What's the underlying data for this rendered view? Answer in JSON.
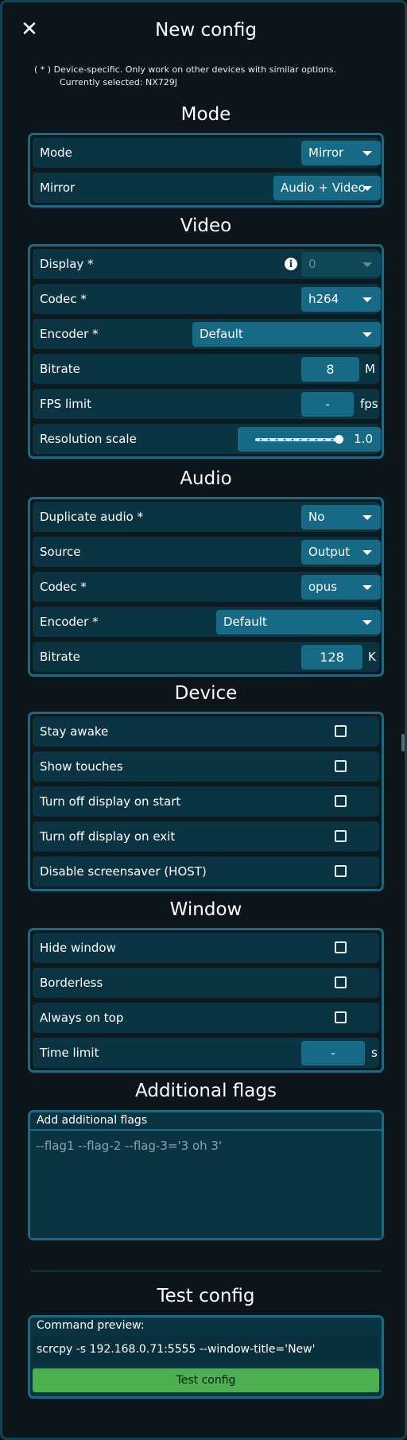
{
  "header": {
    "title": "New config",
    "close_icon": "close-icon"
  },
  "note": {
    "line1": "( * ) Device-specific. Only work on other devices with similar options.",
    "line2": "Currently selected: NX729J"
  },
  "mode": {
    "title": "Mode",
    "mode_label": "Mode",
    "mode_value": "Mirror",
    "mirror_label": "Mirror",
    "mirror_value": "Audio + Video"
  },
  "video": {
    "title": "Video",
    "display_label": "Display *",
    "display_value": "0",
    "codec_label": "Codec *",
    "codec_value": "h264",
    "encoder_label": "Encoder *",
    "encoder_value": "Default",
    "bitrate_label": "Bitrate",
    "bitrate_value": "8",
    "bitrate_unit": "M",
    "fps_label": "FPS limit",
    "fps_value": "-",
    "fps_unit": "fps",
    "scale_label": "Resolution scale",
    "scale_value": "1.0",
    "scale_level": 1.0
  },
  "audio": {
    "title": "Audio",
    "duplicate_label": "Duplicate audio *",
    "duplicate_value": "No",
    "source_label": "Source",
    "source_value": "Output",
    "codec_label": "Codec *",
    "codec_value": "opus",
    "encoder_label": "Encoder *",
    "encoder_value": "Default",
    "bitrate_label": "Bitrate",
    "bitrate_value": "128",
    "bitrate_unit": "K"
  },
  "device": {
    "title": "Device",
    "items": [
      {
        "label": "Stay awake",
        "checked": false
      },
      {
        "label": "Show touches",
        "checked": false
      },
      {
        "label": "Turn off display on start",
        "checked": false
      },
      {
        "label": "Turn off display on exit",
        "checked": false
      },
      {
        "label": "Disable screensaver (HOST)",
        "checked": false
      }
    ]
  },
  "window": {
    "title": "Window",
    "items": [
      {
        "label": "Hide window",
        "checked": false
      },
      {
        "label": "Borderless",
        "checked": false
      },
      {
        "label": "Always on top",
        "checked": false
      }
    ],
    "time_label": "Time limit",
    "time_value": "-",
    "time_unit": "s"
  },
  "flags": {
    "title": "Additional flags",
    "label": "Add additional flags",
    "placeholder": "--flag1 --flag-2 --flag-3='3 oh 3'"
  },
  "test": {
    "title": "Test config",
    "preview_label": "Command preview:",
    "preview_value": "scrcpy -s 192.168.0.71:5555 --window-title='New'",
    "button_label": "Test config"
  },
  "colors": {
    "accent": "#176a86",
    "row_bg": "#0b3442",
    "border": "#1a6a84",
    "button_green": "#4caf50"
  }
}
